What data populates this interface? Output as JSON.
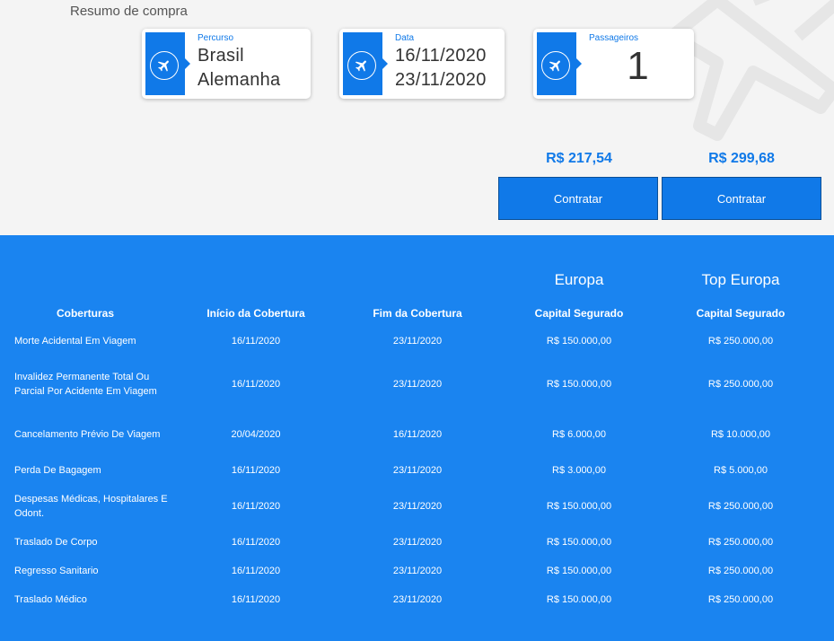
{
  "summary": {
    "title": "Resumo de compra"
  },
  "cards": [
    {
      "label": "Percurso",
      "line1": "Brasil",
      "line2": "Alemanha"
    },
    {
      "label": "Data",
      "line1": "16/11/2020",
      "line2": "23/11/2020"
    },
    {
      "label": "Passageiros",
      "value": "1"
    }
  ],
  "plans": [
    {
      "name": "Europa",
      "price": "R$ 217,54",
      "button": "Contratar"
    },
    {
      "name": "Top Europa",
      "price": "R$ 299,68",
      "button": "Contratar"
    }
  ],
  "table": {
    "headers": [
      "Coberturas",
      "Início da Cobertura",
      "Fim da Cobertura",
      "Capital Segurado",
      "Capital Segurado"
    ],
    "rows": [
      [
        "Morte Acidental Em Viagem",
        "16/11/2020",
        "23/11/2020",
        "R$ 150.000,00",
        "R$ 250.000,00"
      ],
      [
        "Invalidez Permanente Total Ou Parcial Por Acidente Em Viagem",
        "16/11/2020",
        "23/11/2020",
        "R$ 150.000,00",
        "R$ 250.000,00"
      ],
      [
        "Cancelamento Prévio De Viagem",
        "20/04/2020",
        "16/11/2020",
        "R$ 6.000,00",
        "R$ 10.000,00"
      ],
      [
        "Perda De Bagagem",
        "16/11/2020",
        "23/11/2020",
        "R$ 3.000,00",
        "R$ 5.000,00"
      ],
      [
        "Despesas Médicas, Hospitalares E Odont.",
        "16/11/2020",
        "23/11/2020",
        "R$ 150.000,00",
        "R$ 250.000,00"
      ],
      [
        "Traslado De Corpo",
        "16/11/2020",
        "23/11/2020",
        "R$ 150.000,00",
        "R$ 250.000,00"
      ],
      [
        "Regresso Sanitario",
        "16/11/2020",
        "23/11/2020",
        "R$ 150.000,00",
        "R$ 250.000,00"
      ],
      [
        "Traslado Médico",
        "16/11/2020",
        "23/11/2020",
        "R$ 150.000,00",
        "R$ 250.000,00"
      ]
    ]
  },
  "colors": {
    "primary": "#1079e8",
    "tableBg": "#1a84f0"
  }
}
